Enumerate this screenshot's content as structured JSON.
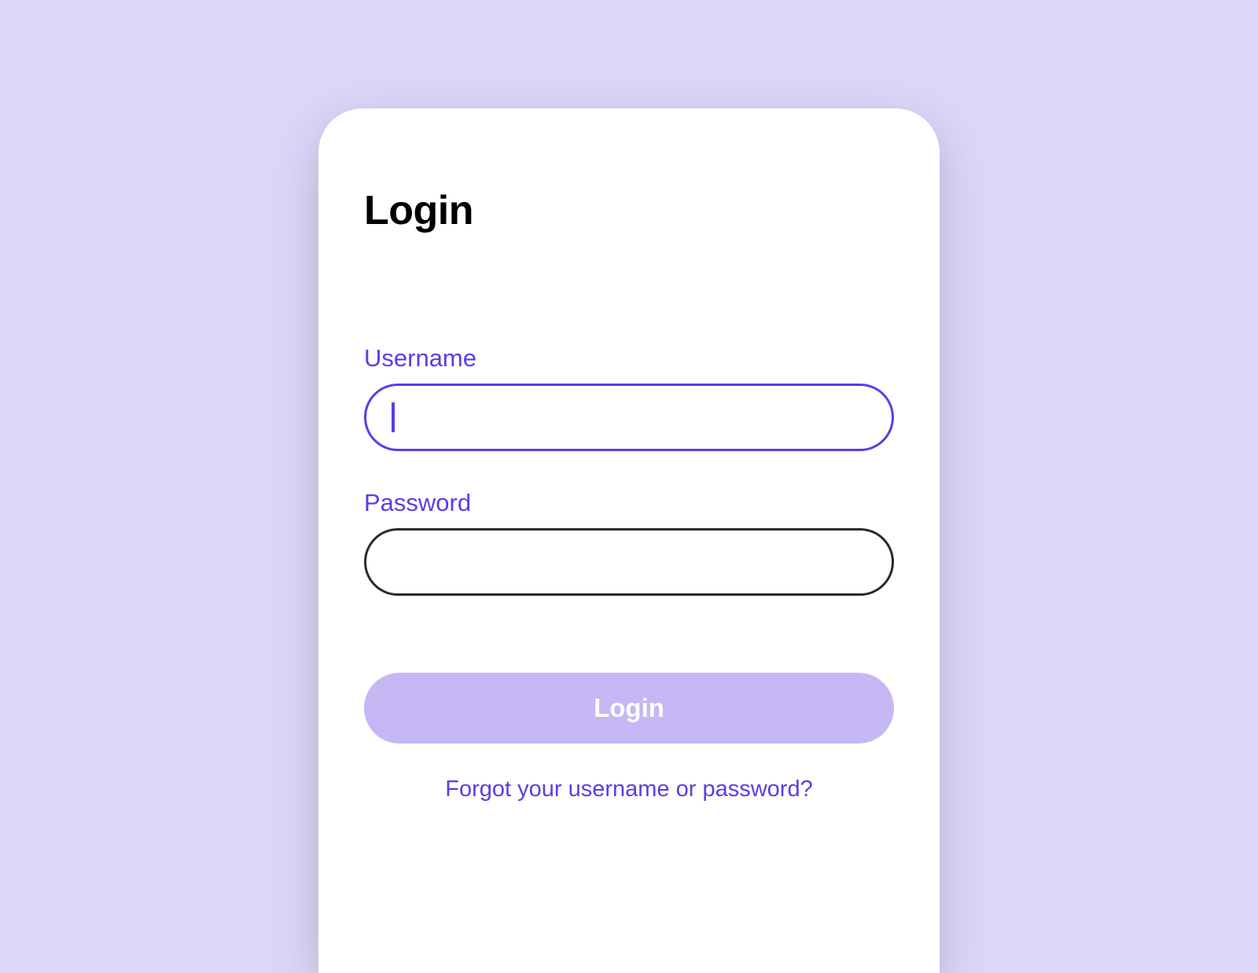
{
  "card": {
    "title": "Login",
    "username": {
      "label": "Username",
      "value": ""
    },
    "password": {
      "label": "Password",
      "value": ""
    },
    "loginButton": "Login",
    "forgotLink": "Forgot your username or password?"
  },
  "colors": {
    "background": "#DDD6F9",
    "card": "#FFFFFF",
    "accent": "#5A3DE6",
    "buttonBg": "#C5B7F3",
    "inputInactiveBorder": "#2A2A2A"
  }
}
